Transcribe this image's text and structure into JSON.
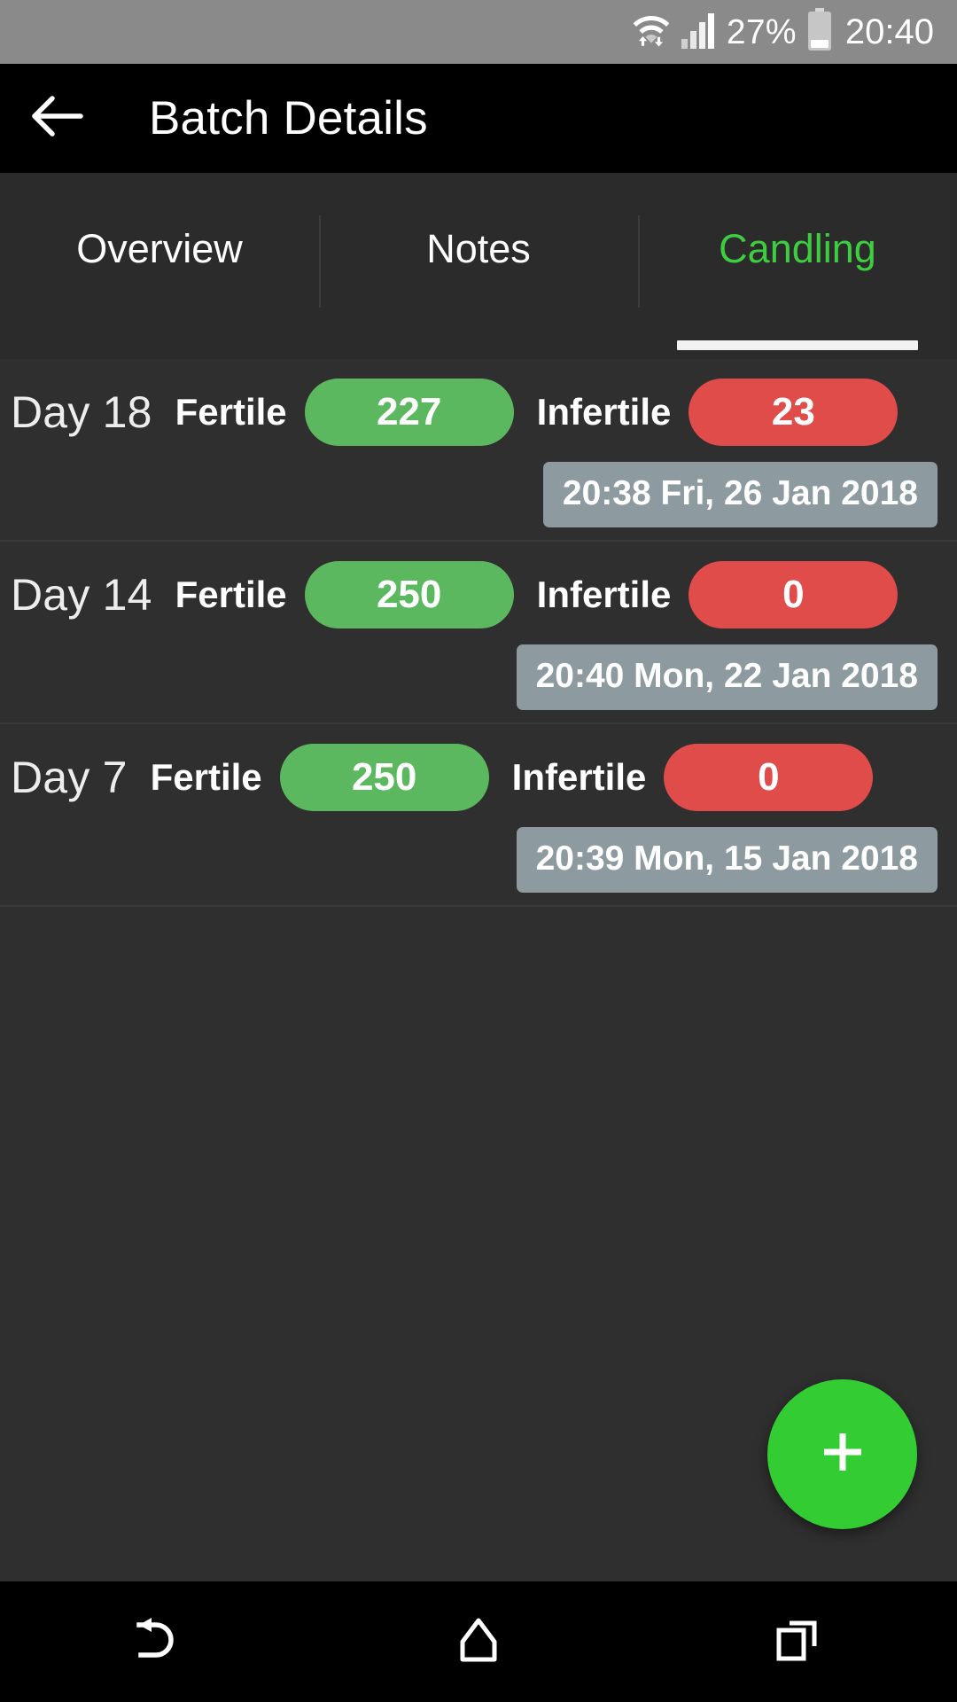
{
  "status_bar": {
    "wifi_icon": "wifi-data-transfer-icon",
    "signal_icon": "cellular-signal-icon",
    "battery_percent": "27%",
    "battery_icon": "battery-low-icon",
    "clock": "20:40",
    "background_color": "#8a8a8a"
  },
  "app_bar": {
    "back_icon": "back-arrow-icon",
    "title": "Batch Details",
    "background_color": "#000000"
  },
  "tabs": {
    "items": [
      {
        "label": "Overview",
        "active": false
      },
      {
        "label": "Notes",
        "active": false
      },
      {
        "label": "Candling",
        "active": true
      }
    ],
    "active_color": "#3ecc41",
    "indicator_color": "#f2f2f2"
  },
  "candling": {
    "fertile_label": "Fertile",
    "infertile_label": "Infertile",
    "fertile_color": "#5cb85f",
    "infertile_color": "#df4c4a",
    "timestamp_color": "#8d9aa0",
    "entries": [
      {
        "day": "Day 18",
        "fertile": "227",
        "infertile": "23",
        "timestamp": "20:38 Fri, 26 Jan 2018"
      },
      {
        "day": "Day 14",
        "fertile": "250",
        "infertile": "0",
        "timestamp": "20:40 Mon, 22 Jan 2018"
      },
      {
        "day": "Day 7",
        "fertile": "250",
        "infertile": "0",
        "timestamp": "20:39 Mon, 15 Jan 2018"
      }
    ]
  },
  "fab": {
    "icon": "plus-icon",
    "color": "#33cc33"
  },
  "nav_bar": {
    "back_icon": "system-back-icon",
    "home_icon": "system-home-icon",
    "recents_icon": "system-recents-icon",
    "background_color": "#000000"
  }
}
